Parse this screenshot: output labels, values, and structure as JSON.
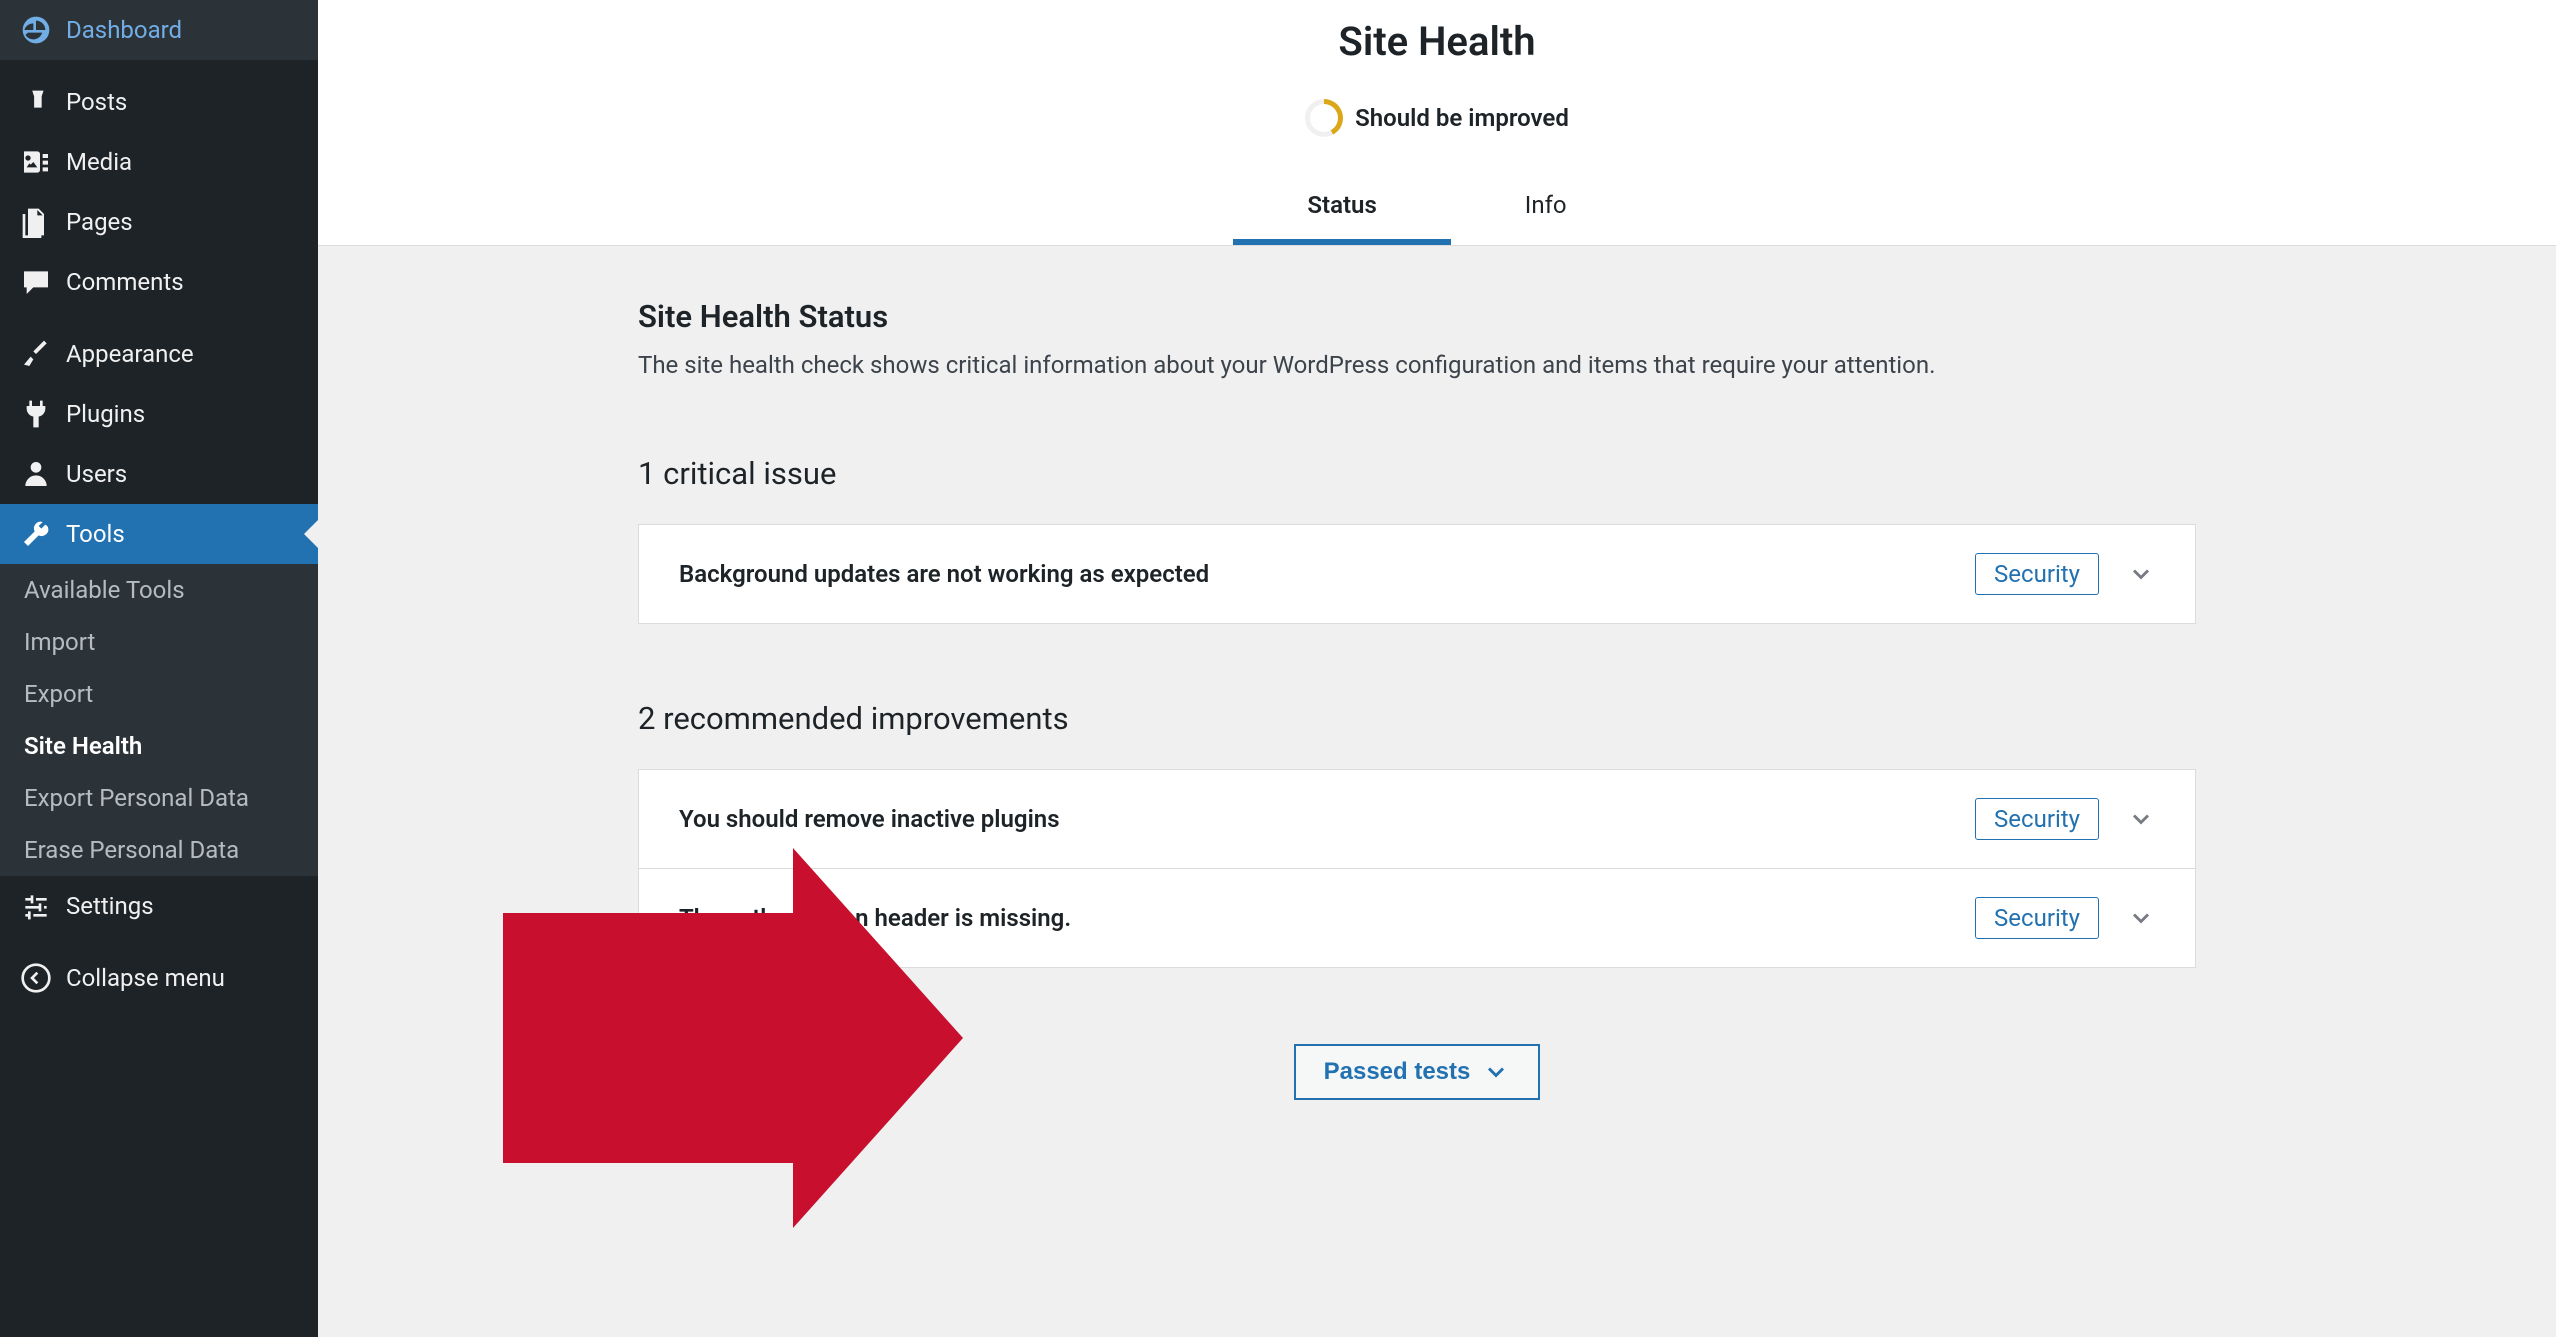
{
  "sidebar": {
    "items": [
      {
        "label": "Dashboard",
        "icon": "dashboard"
      },
      {
        "label": "Posts",
        "icon": "pin"
      },
      {
        "label": "Media",
        "icon": "media"
      },
      {
        "label": "Pages",
        "icon": "pages"
      },
      {
        "label": "Comments",
        "icon": "comment"
      },
      {
        "label": "Appearance",
        "icon": "brush"
      },
      {
        "label": "Plugins",
        "icon": "plug"
      },
      {
        "label": "Users",
        "icon": "user"
      },
      {
        "label": "Tools",
        "icon": "wrench"
      },
      {
        "label": "Settings",
        "icon": "sliders"
      },
      {
        "label": "Collapse menu",
        "icon": "collapse"
      }
    ],
    "submenu": [
      "Available Tools",
      "Import",
      "Export",
      "Site Health",
      "Export Personal Data",
      "Erase Personal Data"
    ]
  },
  "header": {
    "title": "Site Health",
    "status": "Should be improved",
    "tabs": [
      "Status",
      "Info"
    ]
  },
  "section": {
    "title": "Site Health Status",
    "description": "The site health check shows critical information about your WordPress configuration and items that require your attention."
  },
  "critical": {
    "heading": "1 critical issue",
    "items": [
      {
        "title": "Background updates are not working as expected",
        "badge": "Security"
      }
    ]
  },
  "recommended": {
    "heading": "2 recommended improvements",
    "items": [
      {
        "title": "You should remove inactive plugins",
        "badge": "Security"
      },
      {
        "title": "The authorization header is missing.",
        "badge": "Security"
      }
    ]
  },
  "passed": {
    "label": "Passed tests"
  }
}
